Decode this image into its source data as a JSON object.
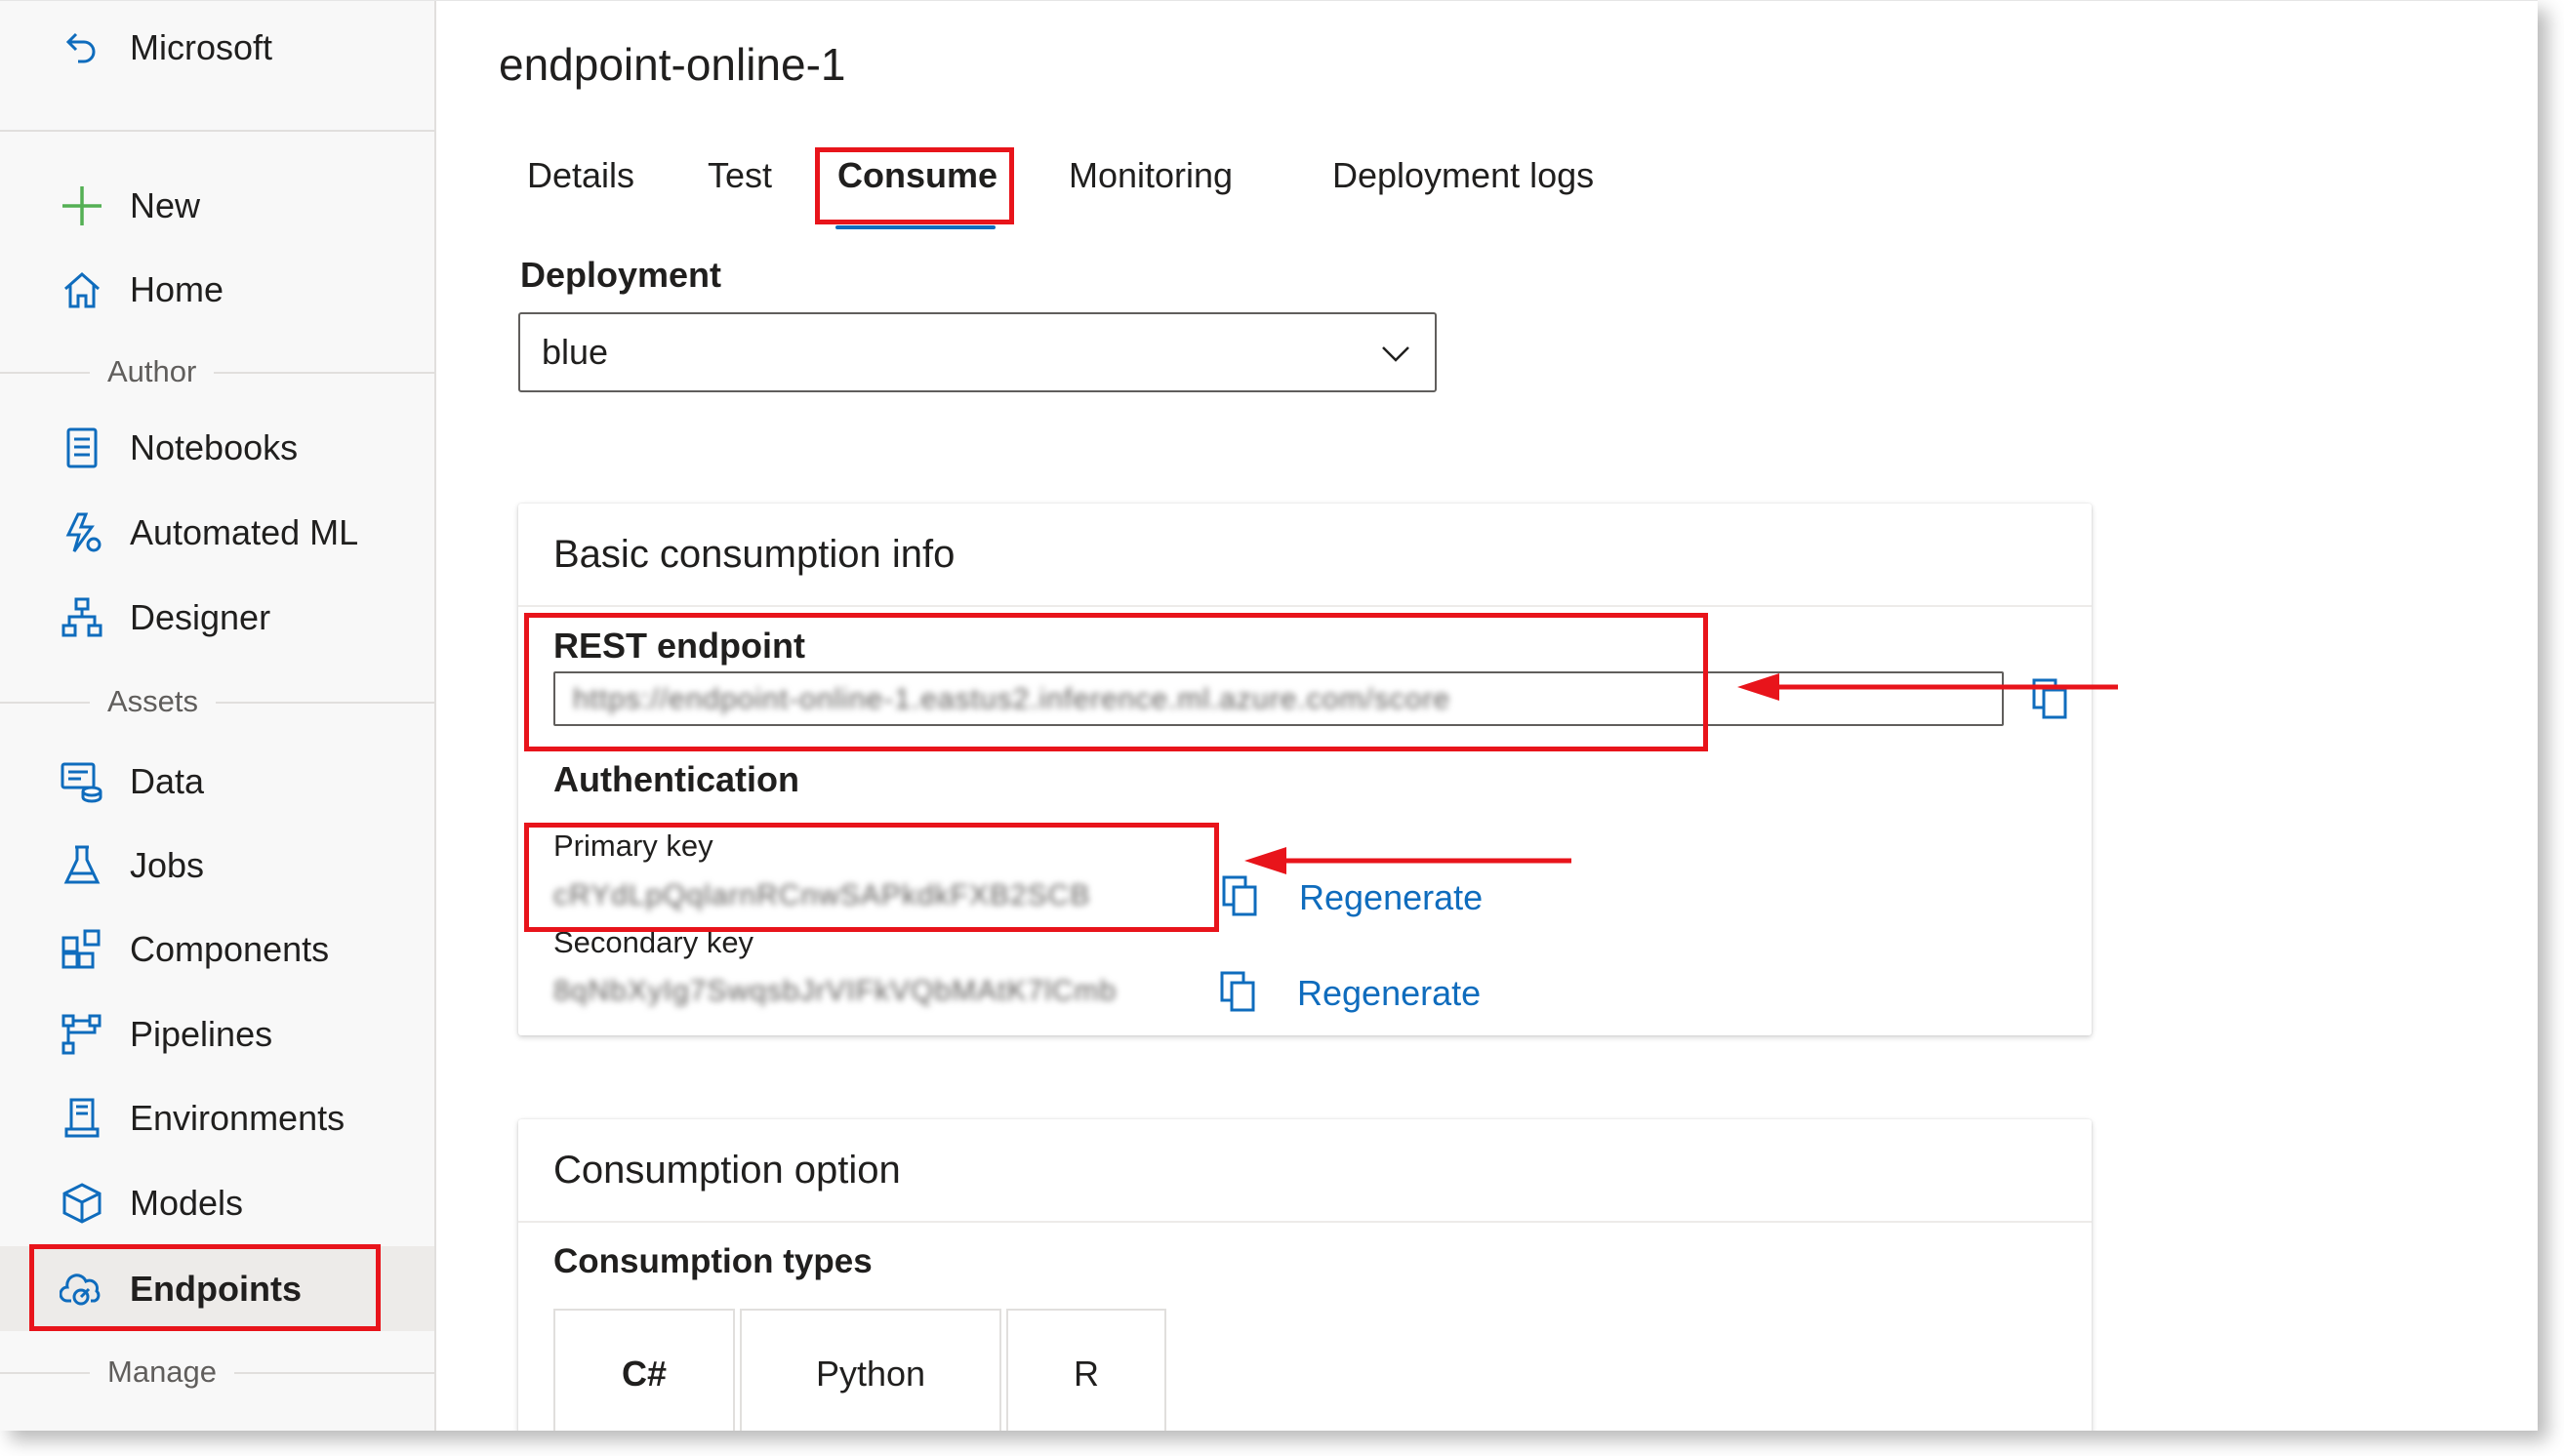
{
  "sidebar": {
    "org": "Microsoft",
    "items_top": [
      {
        "label": "New",
        "icon": "plus-icon"
      },
      {
        "label": "Home",
        "icon": "home-icon"
      }
    ],
    "section_author": "Author",
    "items_author": [
      {
        "label": "Notebooks",
        "icon": "notebook-icon"
      },
      {
        "label": "Automated ML",
        "icon": "automated-ml-icon"
      },
      {
        "label": "Designer",
        "icon": "designer-icon"
      }
    ],
    "section_assets": "Assets",
    "items_assets": [
      {
        "label": "Data",
        "icon": "data-icon"
      },
      {
        "label": "Jobs",
        "icon": "flask-icon"
      },
      {
        "label": "Components",
        "icon": "components-icon"
      },
      {
        "label": "Pipelines",
        "icon": "pipelines-icon"
      },
      {
        "label": "Environments",
        "icon": "environments-icon"
      },
      {
        "label": "Models",
        "icon": "cube-icon"
      },
      {
        "label": "Endpoints",
        "icon": "endpoints-icon",
        "active": true
      }
    ],
    "section_manage": "Manage"
  },
  "page": {
    "title": "endpoint-online-1",
    "tabs": [
      {
        "label": "Details"
      },
      {
        "label": "Test"
      },
      {
        "label": "Consume",
        "active": true
      },
      {
        "label": "Monitoring"
      },
      {
        "label": "Deployment logs"
      }
    ]
  },
  "deployment": {
    "label": "Deployment",
    "selected": "blue"
  },
  "basic_info": {
    "title": "Basic consumption info",
    "rest_label": "REST endpoint",
    "rest_value": "https://endpoint-online-1.eastus2.inference.ml.azure.com/score",
    "auth_label": "Authentication",
    "primary_label": "Primary key",
    "primary_value": "cRYdLpQqlarnRCnwSAPkdkFXB2SCB",
    "secondary_label": "Secondary key",
    "secondary_value": "8qNbXyIg7SwqsbJrVIFkVQbMAtK7lCmb",
    "regenerate": "Regenerate"
  },
  "consumption": {
    "title": "Consumption option",
    "types_label": "Consumption types",
    "types": [
      {
        "label": "C#",
        "active": true
      },
      {
        "label": "Python"
      },
      {
        "label": "R"
      }
    ]
  },
  "colors": {
    "accent": "#0f6cbd",
    "annotation_red": "#e8141b",
    "sidebar_bg": "#f8f8f8"
  }
}
